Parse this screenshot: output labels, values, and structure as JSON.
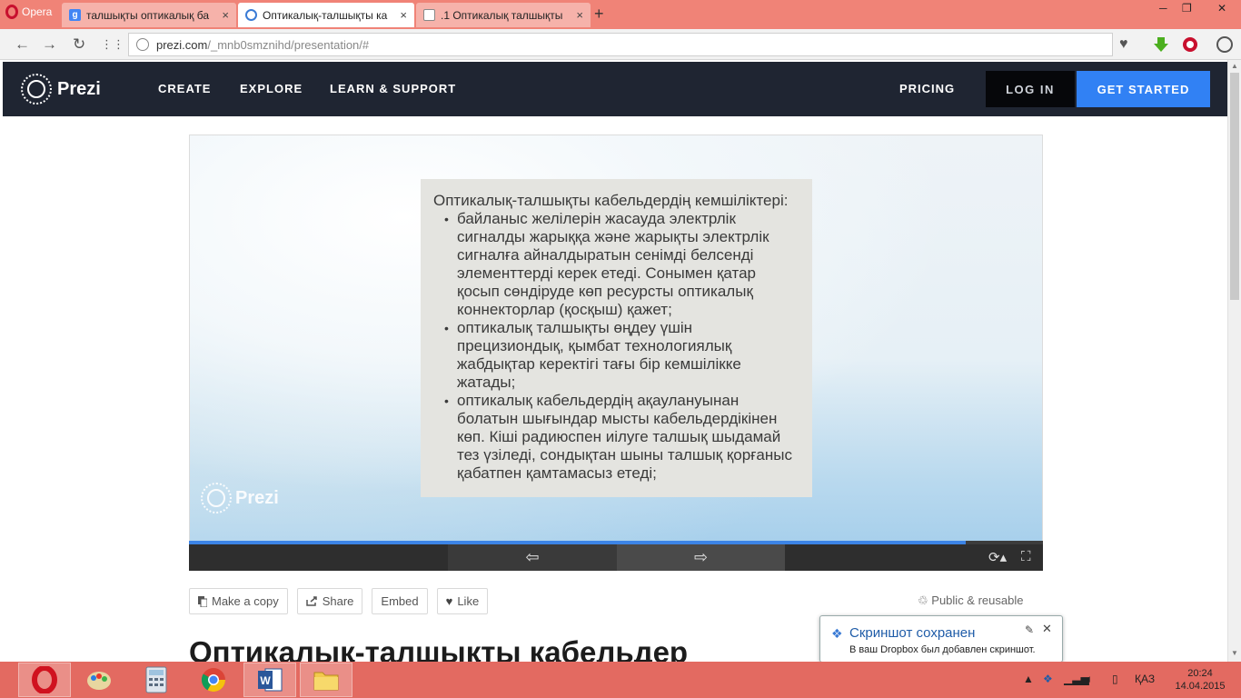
{
  "browser": {
    "opera_label": "Opera",
    "tabs": [
      {
        "title": "талшықты оптикалық ба",
        "close": "×"
      },
      {
        "title": "Оптикалық-талшықты ка",
        "close": "×"
      },
      {
        "title": ".1 Оптикалық талшықты",
        "close": "×"
      }
    ],
    "new_tab": "+",
    "url_host": "prezi.com",
    "url_path": "/_mnb0smznihd/presentation/#",
    "window_controls": {
      "minimize": "─",
      "restore": "❐",
      "close": "✕"
    },
    "nav": {
      "back": "←",
      "forward": "→",
      "reload": "↻",
      "speed_dial": "⋮⋮"
    },
    "heart": "♥"
  },
  "prezi_nav": {
    "brand": "Prezi",
    "links": [
      "CREATE",
      "EXPLORE",
      "LEARN & SUPPORT"
    ],
    "pricing": "PRICING",
    "login": "LOG IN",
    "get_started": "GET STARTED"
  },
  "slide": {
    "title": "Оптикалық-талшықты кабельдердің кемшіліктері:",
    "bullets": [
      " байланыс желілерін жасауда электрлік сигналды жарыққа және жарықты электрлік сигналға айналдыратын сенімді белсенді элементтерді керек етеді. Сонымен қатар қосып сөндіруде көп ресурсты оптикалық коннекторлар (қосқыш) қажет;",
      "оптикалық талшықты өңдеу үшін прецизиондық, қымбат технологиялық жабдықтар керектігі тағы бір кемшілікке жатады;",
      "оптикалық кабельдердің ақаулануынан болатын шығындар мысты кабельдердікінен көп. Кіші радиюспен иілуге талшық шыдамай тез үзіледі, сондықтан шыны талшық қорғаныс қабатпен қамтамасыз етеді;"
    ],
    "watermark": "Prezi",
    "progress": 0.91
  },
  "controls": {
    "prev": "⇦",
    "next": "⇨",
    "autoplay": "⟳▴",
    "fullscreen": "⛶"
  },
  "actions": {
    "make_copy": "Make a copy",
    "share": "Share",
    "embed": "Embed",
    "like": "Like",
    "public": "Public & reusable"
  },
  "presentation_title": "Оптикалық-талшықты кабельдер",
  "toast": {
    "title": "Скриншот сохранен",
    "text": "В ваш Dropbox был добавлен скриншот."
  },
  "taskbar": {
    "language": "ҚАЗ",
    "time": "20:24",
    "date": "14.04.2015"
  }
}
